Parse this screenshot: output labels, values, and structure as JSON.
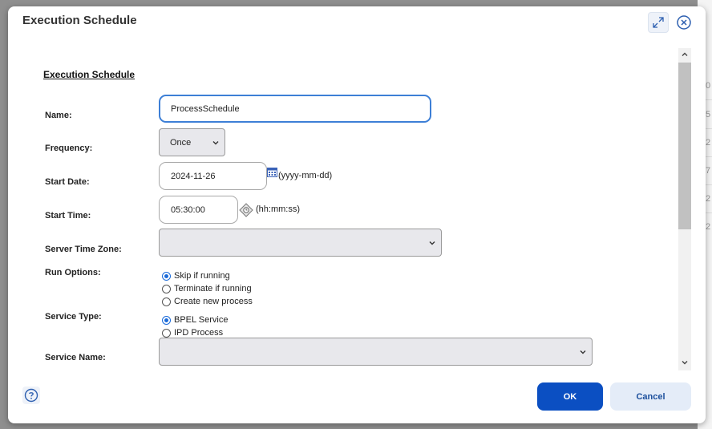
{
  "background": {
    "side_fragments": [
      "0",
      "5",
      "2",
      "7",
      "2",
      "2"
    ]
  },
  "dialog": {
    "title": "Execution Schedule",
    "expand_icon": "expand-icon",
    "close_icon": "close-circle-icon"
  },
  "form": {
    "section_title": "Execution Schedule",
    "name": {
      "label": "Name:",
      "value": "ProcessSchedule"
    },
    "frequency": {
      "label": "Frequency:",
      "value": "Once"
    },
    "start_date": {
      "label": "Start Date:",
      "value": "2024-11-26",
      "hint": "(yyyy-mm-dd)",
      "icon": "calendar-icon"
    },
    "start_time": {
      "label": "Start Time:",
      "value": "05:30:00",
      "hint": "(hh:mm:ss)",
      "icon": "clock-picker-icon"
    },
    "server_time_zone": {
      "label": "Server Time Zone:",
      "value": ""
    },
    "run_options": {
      "label": "Run Options:",
      "options": [
        {
          "label": "Skip if running",
          "selected": true
        },
        {
          "label": "Terminate if running",
          "selected": false
        },
        {
          "label": "Create new process",
          "selected": false
        }
      ]
    },
    "service_type": {
      "label": "Service Type:",
      "options": [
        {
          "label": "BPEL Service",
          "selected": true
        },
        {
          "label": "IPD Process",
          "selected": false
        }
      ]
    },
    "service_name": {
      "label": "Service Name:",
      "value": ""
    }
  },
  "footer": {
    "help_icon": "help-icon",
    "ok_label": "OK",
    "cancel_label": "Cancel"
  },
  "colors": {
    "primary": "#0b4fc2",
    "focus": "#3d7fd6",
    "radio_selected": "#1a6ad9"
  }
}
